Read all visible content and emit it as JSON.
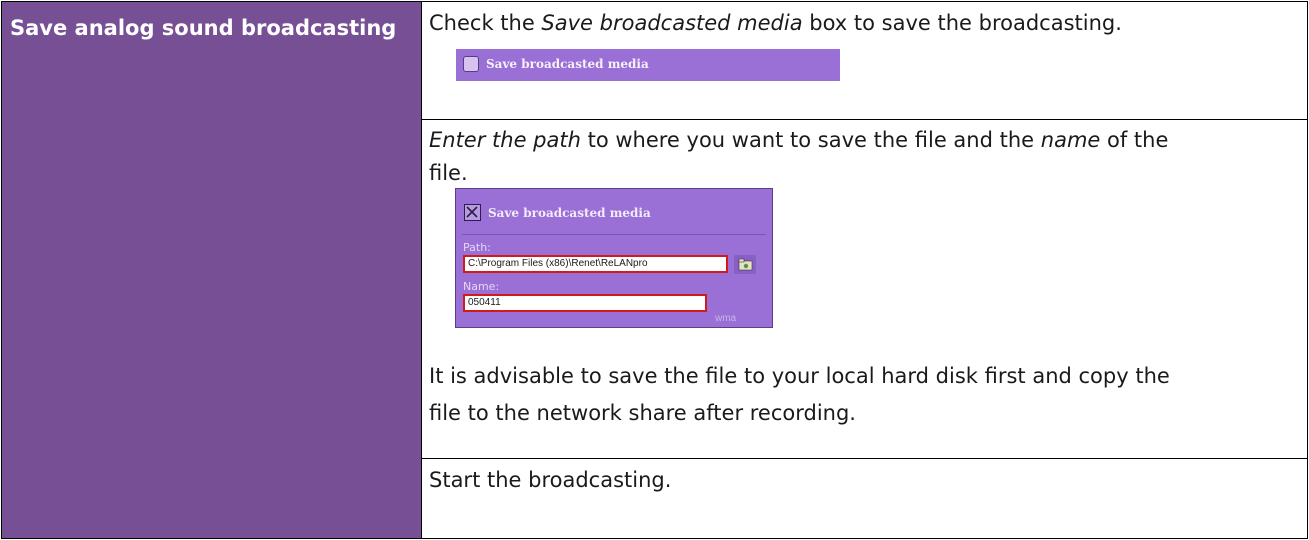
{
  "left": {
    "heading": "Save analog sound broadcasting"
  },
  "row1": {
    "text_before": "Check the ",
    "text_italic": "Save broadcasted media",
    "text_after": " box to save the broadcasting.",
    "checkbox_label": "Save broadcasted media"
  },
  "row2": {
    "line1_italic": "Enter the path",
    "line1_mid": " to where you want to save the file and the ",
    "line1_italic2": "name",
    "line1_after": " of the",
    "line2": "file.",
    "dialog": {
      "title": "Save broadcasted media",
      "path_label": "Path:",
      "path_value": "C:\\Program Files (x86)\\Renet\\ReLANpro",
      "name_label": "Name:",
      "name_value": "050411",
      "extension": "wma"
    },
    "advice_line1": "It is advisable to save the file to your local hard disk first and copy the",
    "advice_line2": "file to the network share after recording."
  },
  "row3": {
    "text": "Start the broadcasting."
  }
}
